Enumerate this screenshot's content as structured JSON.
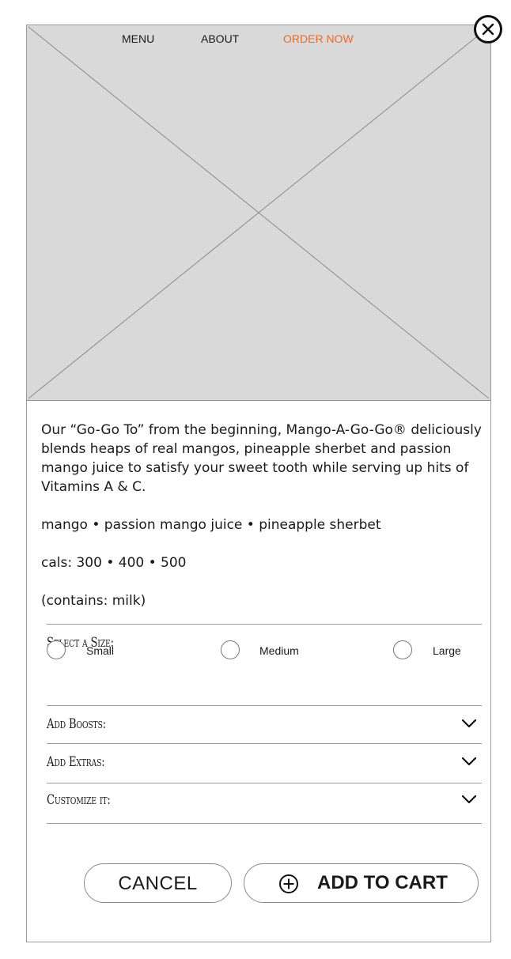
{
  "nav": {
    "items": [
      {
        "label": "MENU"
      },
      {
        "label": "ABOUT"
      },
      {
        "label": "ORDER NOW",
        "active": true
      }
    ],
    "active_color": "#f26a21"
  },
  "close_icon": "close-circle-icon",
  "product": {
    "description": "Our “Go-Go To” from the beginning, Mango-A-Go-Go® deliciously blends heaps of real mangos, pineapple sherbet and passion mango juice to satisfy your sweet tooth while serving up hits of Vitamins A & C.",
    "ingredients": "mango • passion mango juice • pineapple sherbet",
    "calories": "cals: 300 • 400 • 500",
    "allergens": "(contains: milk)"
  },
  "size": {
    "label": "Select a Size:",
    "options": [
      {
        "label": "Small",
        "selected": false
      },
      {
        "label": "Medium",
        "selected": false
      },
      {
        "label": "Large",
        "selected": false
      }
    ]
  },
  "accordions": [
    {
      "label": "Add Boosts:",
      "icon": "chevron-down-icon"
    },
    {
      "label": "Add Extras:",
      "icon": "chevron-down-icon"
    },
    {
      "label": "Customize it:",
      "icon": "chevron-down-icon"
    }
  ],
  "actions": {
    "cancel_label": "CANCEL",
    "add_label": "ADD TO CART",
    "add_icon": "plus-circle-icon"
  }
}
